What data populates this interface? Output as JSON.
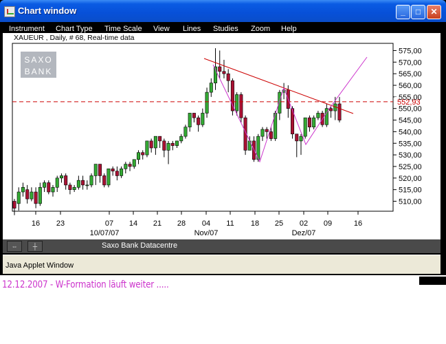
{
  "window": {
    "title": "Chart window"
  },
  "menu": [
    "Instrument",
    "Chart Type",
    "Time Scale",
    "View",
    "Lines",
    "Studies",
    "Zoom",
    "Help"
  ],
  "chart_header": "XAUEUR , Daily, # 68, Real-time data",
  "logo": [
    "SAXO",
    "BANK"
  ],
  "statusbar": {
    "source": "Saxo Bank Datacentre"
  },
  "applet_label": "Java Applet Window",
  "caption": "12.12.2007 - W-Formation läuft weiter .....",
  "colors": {
    "titlebar": "#0a5be3",
    "up_candle": "#33aa33",
    "down_candle": "#aa1133",
    "trendline": "#cc0000",
    "magenta_line": "#cc33cc",
    "caption": "#cc33cc"
  },
  "chart_data": {
    "type": "candlestick",
    "instrument": "XAUEUR",
    "ylim": [
      503,
      580
    ],
    "y_ticks": [
      "575,00",
      "570,00",
      "565,00",
      "560,00",
      "555,00",
      "550,00",
      "545,00",
      "540,00",
      "535,00",
      "530,00",
      "525,00",
      "520,00",
      "515,00",
      "510,00"
    ],
    "current_price": "552,93",
    "x_tick_labels": [
      "16",
      "23",
      "07",
      "14",
      "21",
      "28",
      "04",
      "11",
      "18",
      "25",
      "02",
      "09",
      "16"
    ],
    "x_date_labels": [
      "10/07/07",
      "Nov/07",
      "Dez/07"
    ],
    "candles": [
      [
        510,
        507,
        511,
        504
      ],
      [
        509,
        514,
        516,
        506
      ],
      [
        514,
        516,
        518,
        512
      ],
      [
        515,
        511,
        517,
        509
      ],
      [
        511,
        514,
        516,
        510
      ],
      [
        514,
        509,
        516,
        507
      ],
      [
        509,
        516,
        518,
        508
      ],
      [
        516,
        518,
        519,
        514
      ],
      [
        518,
        514,
        519,
        513
      ],
      [
        514,
        516,
        517,
        512
      ],
      [
        516,
        520,
        521,
        514
      ],
      [
        520,
        521,
        522,
        518
      ],
      [
        521,
        517,
        522,
        515
      ],
      [
        517,
        515,
        518,
        513
      ],
      [
        515,
        516,
        517,
        514
      ],
      [
        516,
        519,
        521,
        515
      ],
      [
        519,
        517,
        521,
        515
      ],
      [
        517,
        517,
        519,
        515
      ],
      [
        517,
        521,
        522,
        516
      ],
      [
        521,
        526,
        526,
        517
      ],
      [
        526,
        521,
        526,
        518
      ],
      [
        521,
        517,
        522,
        516
      ],
      [
        517,
        524,
        524,
        516
      ],
      [
        524,
        523,
        525,
        521
      ],
      [
        523,
        521,
        525,
        519
      ],
      [
        521,
        524,
        525,
        520
      ],
      [
        524,
        526,
        527,
        522
      ],
      [
        526,
        525,
        527,
        523
      ],
      [
        525,
        528,
        528,
        524
      ],
      [
        528,
        531,
        532,
        526
      ],
      [
        531,
        530,
        532,
        528
      ],
      [
        530,
        536,
        536,
        529
      ],
      [
        536,
        533,
        537,
        531
      ],
      [
        533,
        538,
        538,
        530
      ],
      [
        538,
        536,
        538,
        533
      ],
      [
        536,
        532,
        537,
        529
      ],
      [
        532,
        535,
        536,
        526
      ],
      [
        535,
        534,
        536,
        532
      ],
      [
        534,
        536,
        536,
        533
      ],
      [
        536,
        538,
        539,
        535
      ],
      [
        538,
        542,
        543,
        537
      ],
      [
        542,
        548,
        548,
        540
      ],
      [
        548,
        546,
        548,
        544
      ],
      [
        546,
        543,
        547,
        540
      ],
      [
        543,
        548,
        550,
        542
      ],
      [
        548,
        557,
        559,
        546
      ],
      [
        557,
        561,
        563,
        555
      ],
      [
        561,
        568,
        576,
        558
      ],
      [
        568,
        566,
        575,
        563
      ],
      [
        566,
        565,
        571,
        563
      ],
      [
        565,
        562,
        567,
        557
      ],
      [
        562,
        549,
        563,
        547
      ],
      [
        549,
        556,
        557,
        547
      ],
      [
        556,
        546,
        557,
        544
      ],
      [
        546,
        532,
        547,
        530
      ],
      [
        532,
        536,
        538,
        532
      ],
      [
        536,
        528,
        538,
        527
      ],
      [
        528,
        538,
        539,
        527
      ],
      [
        538,
        541,
        542,
        536
      ],
      [
        541,
        540,
        542,
        537
      ],
      [
        540,
        537,
        542,
        536
      ],
      [
        537,
        548,
        549,
        536
      ],
      [
        548,
        557,
        558,
        545
      ],
      [
        557,
        558,
        561,
        554
      ],
      [
        558,
        550,
        560,
        546
      ],
      [
        550,
        539,
        551,
        537
      ],
      [
        539,
        536,
        539,
        529
      ],
      [
        536,
        538,
        539,
        530
      ],
      [
        538,
        546,
        546,
        537
      ],
      [
        546,
        542,
        547,
        540
      ],
      [
        542,
        546,
        547,
        541
      ],
      [
        546,
        548,
        549,
        545
      ],
      [
        548,
        543,
        549,
        542
      ],
      [
        543,
        550,
        552,
        542
      ],
      [
        550,
        549,
        551,
        546
      ],
      [
        549,
        552,
        555,
        545
      ],
      [
        552,
        545,
        555,
        544
      ]
    ],
    "lines": [
      {
        "name": "trendline",
        "points": [
          [
            297,
            85
          ],
          [
            514,
            165
          ]
        ]
      },
      {
        "name": "w-formation",
        "points": [
          [
            310,
            94
          ],
          [
            378,
            235
          ],
          [
            413,
            128
          ],
          [
            445,
            210
          ],
          [
            479,
            158
          ],
          [
            534,
            83
          ]
        ]
      }
    ]
  }
}
